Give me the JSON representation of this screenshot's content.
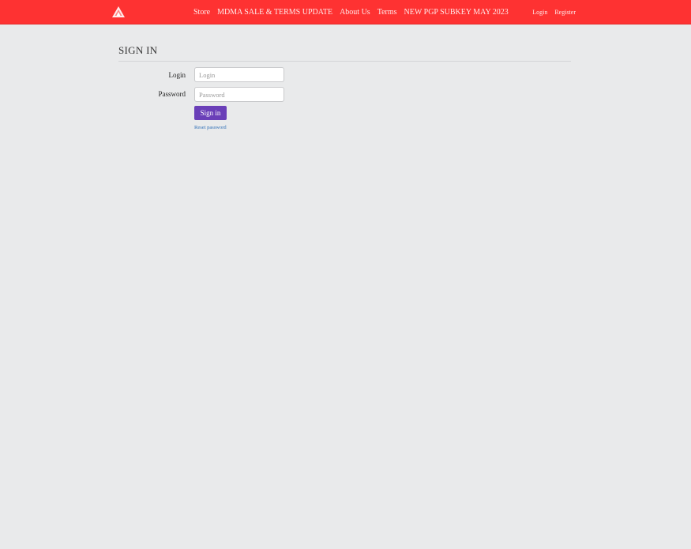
{
  "nav": {
    "logo_icon": "pyramid-logo-icon",
    "links": [
      "Store",
      "MDMA SALE & TERMS UPDATE",
      "About Us",
      "Terms",
      "NEW PGP SUBKEY MAY 2023"
    ],
    "login": "Login",
    "register": "Register",
    "bar_color": "#fe3232"
  },
  "main": {
    "title": "SIGN IN",
    "login_label": "Login",
    "login_placeholder": "Login",
    "password_label": "Password",
    "password_placeholder": "Password",
    "signin_label": "Sign in",
    "signin_color": "#6a3fb8",
    "reset_label": "Reset password"
  }
}
